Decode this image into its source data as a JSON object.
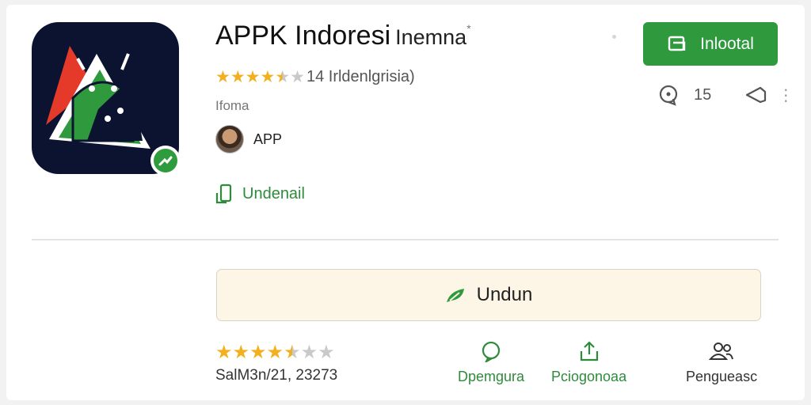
{
  "app": {
    "title": "APPK Indoresi",
    "title_suffix": "Inemna",
    "rating_text": "14 Irldenlgrisia)",
    "category": "Ifoma",
    "developer": "APP",
    "undenail_label": "Undenail",
    "stars": 4.5
  },
  "header_actions": {
    "install_label": "Inlootal",
    "count": "15"
  },
  "main": {
    "download_label": "Undun",
    "bottom_stars": 4.5,
    "date_text": "SalM3n/21, 23273"
  },
  "actions": [
    {
      "label": "Dpemgura",
      "icon": "chat-bubble-icon"
    },
    {
      "label": "Pciogonoaa",
      "icon": "share-upload-icon"
    },
    {
      "label": "Pengueasc",
      "icon": "users-icon"
    }
  ],
  "colors": {
    "primary_green": "#2f9a3d",
    "star_gold": "#f2b01e",
    "icon_bg": "#0b1330",
    "download_bg": "#fdf6e7"
  }
}
